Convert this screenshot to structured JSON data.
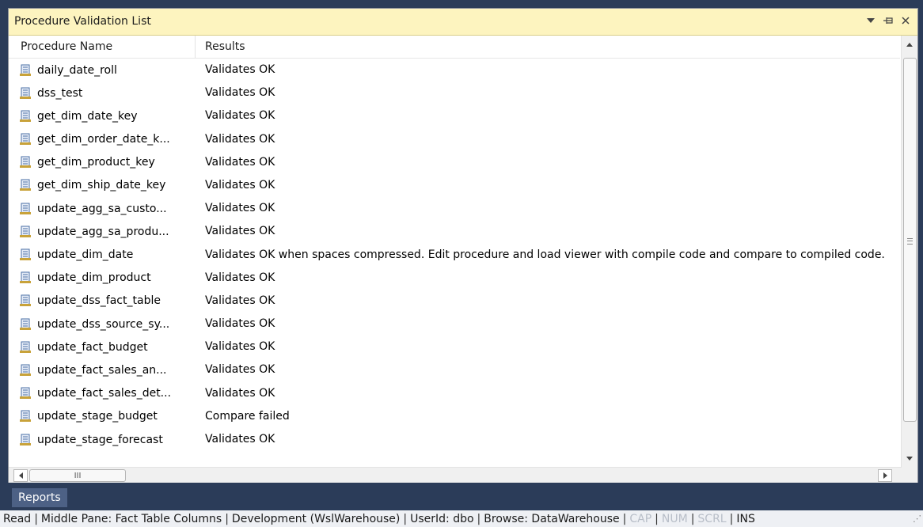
{
  "panel": {
    "title": "Procedure Validation List",
    "columns": {
      "name": "Procedure Name",
      "results": "Results"
    },
    "rows": [
      {
        "name": "daily_date_roll",
        "result": "Validates OK"
      },
      {
        "name": "dss_test",
        "result": "Validates OK"
      },
      {
        "name": "get_dim_date_key",
        "result": "Validates OK"
      },
      {
        "name": "get_dim_order_date_k...",
        "result": "Validates OK"
      },
      {
        "name": "get_dim_product_key",
        "result": "Validates OK"
      },
      {
        "name": "get_dim_ship_date_key",
        "result": "Validates OK"
      },
      {
        "name": "update_agg_sa_custo...",
        "result": "Validates OK"
      },
      {
        "name": "update_agg_sa_produ...",
        "result": "Validates OK"
      },
      {
        "name": "update_dim_date",
        "result": "Validates OK when spaces compressed. Edit procedure and load viewer with compile code and compare to compiled code."
      },
      {
        "name": "update_dim_product",
        "result": "Validates OK"
      },
      {
        "name": "update_dss_fact_table",
        "result": "Validates OK"
      },
      {
        "name": "update_dss_source_sy...",
        "result": "Validates OK"
      },
      {
        "name": "update_fact_budget",
        "result": "Validates OK"
      },
      {
        "name": "update_fact_sales_an...",
        "result": "Validates OK"
      },
      {
        "name": "update_fact_sales_det...",
        "result": "Validates OK"
      },
      {
        "name": "update_stage_budget",
        "result": "Compare failed"
      },
      {
        "name": "update_stage_forecast",
        "result": "Validates OK"
      }
    ],
    "header_icons": [
      "dropdown-icon",
      "pin-icon",
      "close-icon"
    ]
  },
  "hscroll": {
    "thumb_label": "III"
  },
  "tabs": {
    "reports": "Reports"
  },
  "status": {
    "items": [
      {
        "text": "Read",
        "dim": false
      },
      {
        "text": "Middle Pane: Fact Table Columns",
        "dim": false
      },
      {
        "text": "Development (WslWarehouse)",
        "dim": false
      },
      {
        "text": "UserId: dbo",
        "dim": false
      },
      {
        "text": "Browse: DataWarehouse",
        "dim": false
      },
      {
        "text": "CAP",
        "dim": true
      },
      {
        "text": "NUM",
        "dim": true
      },
      {
        "text": "SCRL",
        "dim": true
      },
      {
        "text": "INS",
        "dim": false
      }
    ]
  },
  "colors": {
    "background": "#2b3c59",
    "header": "#fdf4bf",
    "tab": "#4d6185"
  }
}
